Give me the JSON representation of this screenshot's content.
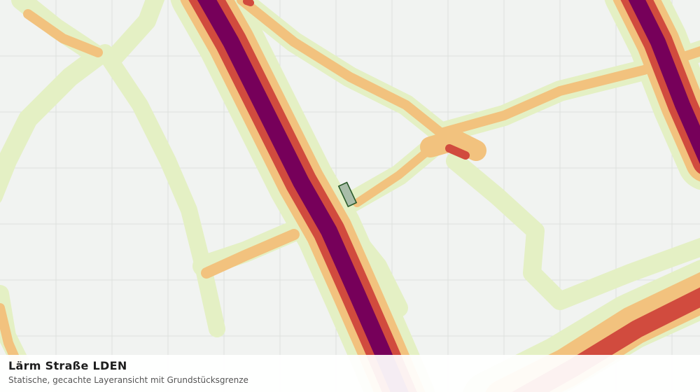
{
  "caption": {
    "title": "Lärm Straße LDEN",
    "subtitle": "Statische, gecachte Layeransicht mit Grundstücksgrenze"
  },
  "noise_colors": {
    "band_lowest": "#e4f0c4",
    "band_low": "#f2c27e",
    "band_mid": "#d14b3e",
    "band_high": "#76005a",
    "parcel_fill": "#a9bda9",
    "parcel_outline": "#2a5a2a",
    "grid": "#dde1dd",
    "background": "#f1f3f1"
  }
}
